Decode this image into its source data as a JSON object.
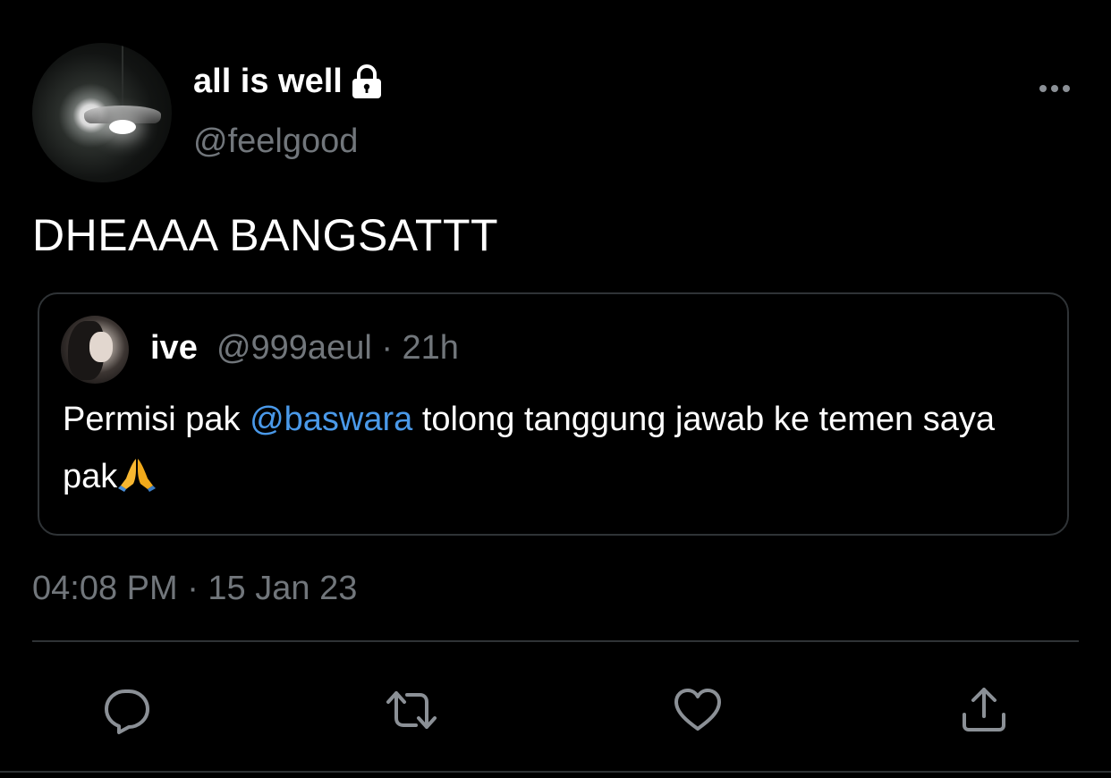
{
  "tweet": {
    "display_name": "all is well",
    "handle": "@feelgood",
    "text": "DHEAAA BANGSATTT",
    "timestamp": "04:08 PM · 15 Jan 23"
  },
  "quoted": {
    "name": "ive",
    "meta": "@999aeul · 21h",
    "text_before": "Permisi pak ",
    "mention": "@baswara",
    "text_after": " tolong tanggung jawab ke temen saya pak"
  },
  "icons": {
    "lock": "lock-icon",
    "more": "more-icon",
    "reply": "reply-icon",
    "retweet": "retweet-icon",
    "like": "heart-icon",
    "share": "share-icon",
    "emoji": "folded-hands-icon"
  },
  "colors": {
    "background": "#000000",
    "text": "#ffffff",
    "secondary": "#71767b",
    "mention": "#4a99e9",
    "border": "#2f3336"
  }
}
